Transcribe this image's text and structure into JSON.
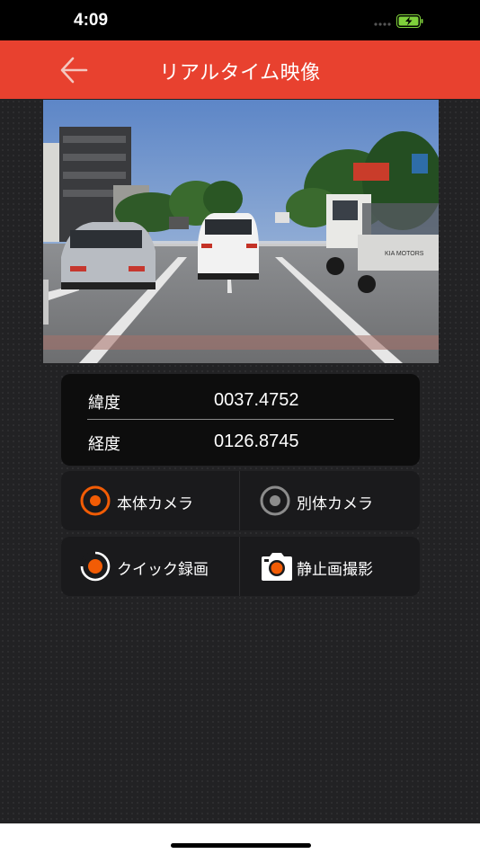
{
  "status_bar": {
    "time": "4:09",
    "battery_icon": "battery-charging-icon",
    "signal_icon": "cellular-signal-icon"
  },
  "header": {
    "title": "リアルタイム映像",
    "back_icon": "arrow-left-icon",
    "background_color": "#e8412f"
  },
  "video": {
    "description_icon": "live-video-feed",
    "truck_text": "KIA MOTORS"
  },
  "coordinates": {
    "latitude_label": "緯度",
    "latitude_value": "0037.4752",
    "longitude_label": "経度",
    "longitude_value": "0126.8745"
  },
  "camera_select": {
    "main_camera_label": "本体カメラ",
    "main_camera_selected": true,
    "sub_camera_label": "別体カメラ",
    "sub_camera_selected": false,
    "accent_color": "#f25c05",
    "inactive_color": "#8c8c8c"
  },
  "actions": {
    "quick_record_label": "クイック録画",
    "quick_record_icon": "record-icon",
    "snapshot_label": "静止画撮影",
    "snapshot_icon": "camera-icon"
  }
}
